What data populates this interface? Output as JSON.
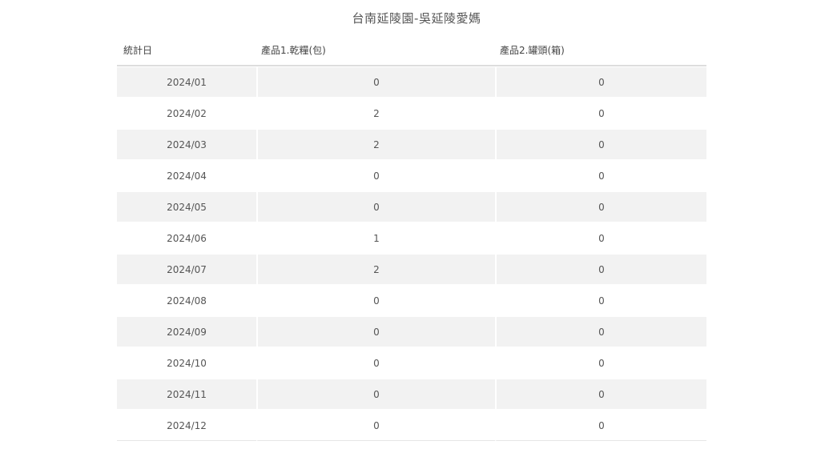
{
  "title": "台南延陵園-吳延陵愛媽",
  "table": {
    "headers": [
      "統計日",
      "產品1.乾糧(包)",
      "產品2.罐頭(箱)"
    ],
    "rows": [
      [
        "2024/01",
        "0",
        "0"
      ],
      [
        "2024/02",
        "2",
        "0"
      ],
      [
        "2024/03",
        "2",
        "0"
      ],
      [
        "2024/04",
        "0",
        "0"
      ],
      [
        "2024/05",
        "0",
        "0"
      ],
      [
        "2024/06",
        "1",
        "0"
      ],
      [
        "2024/07",
        "2",
        "0"
      ],
      [
        "2024/08",
        "0",
        "0"
      ],
      [
        "2024/09",
        "0",
        "0"
      ],
      [
        "2024/10",
        "0",
        "0"
      ],
      [
        "2024/11",
        "0",
        "0"
      ],
      [
        "2024/12",
        "0",
        "0"
      ]
    ]
  }
}
